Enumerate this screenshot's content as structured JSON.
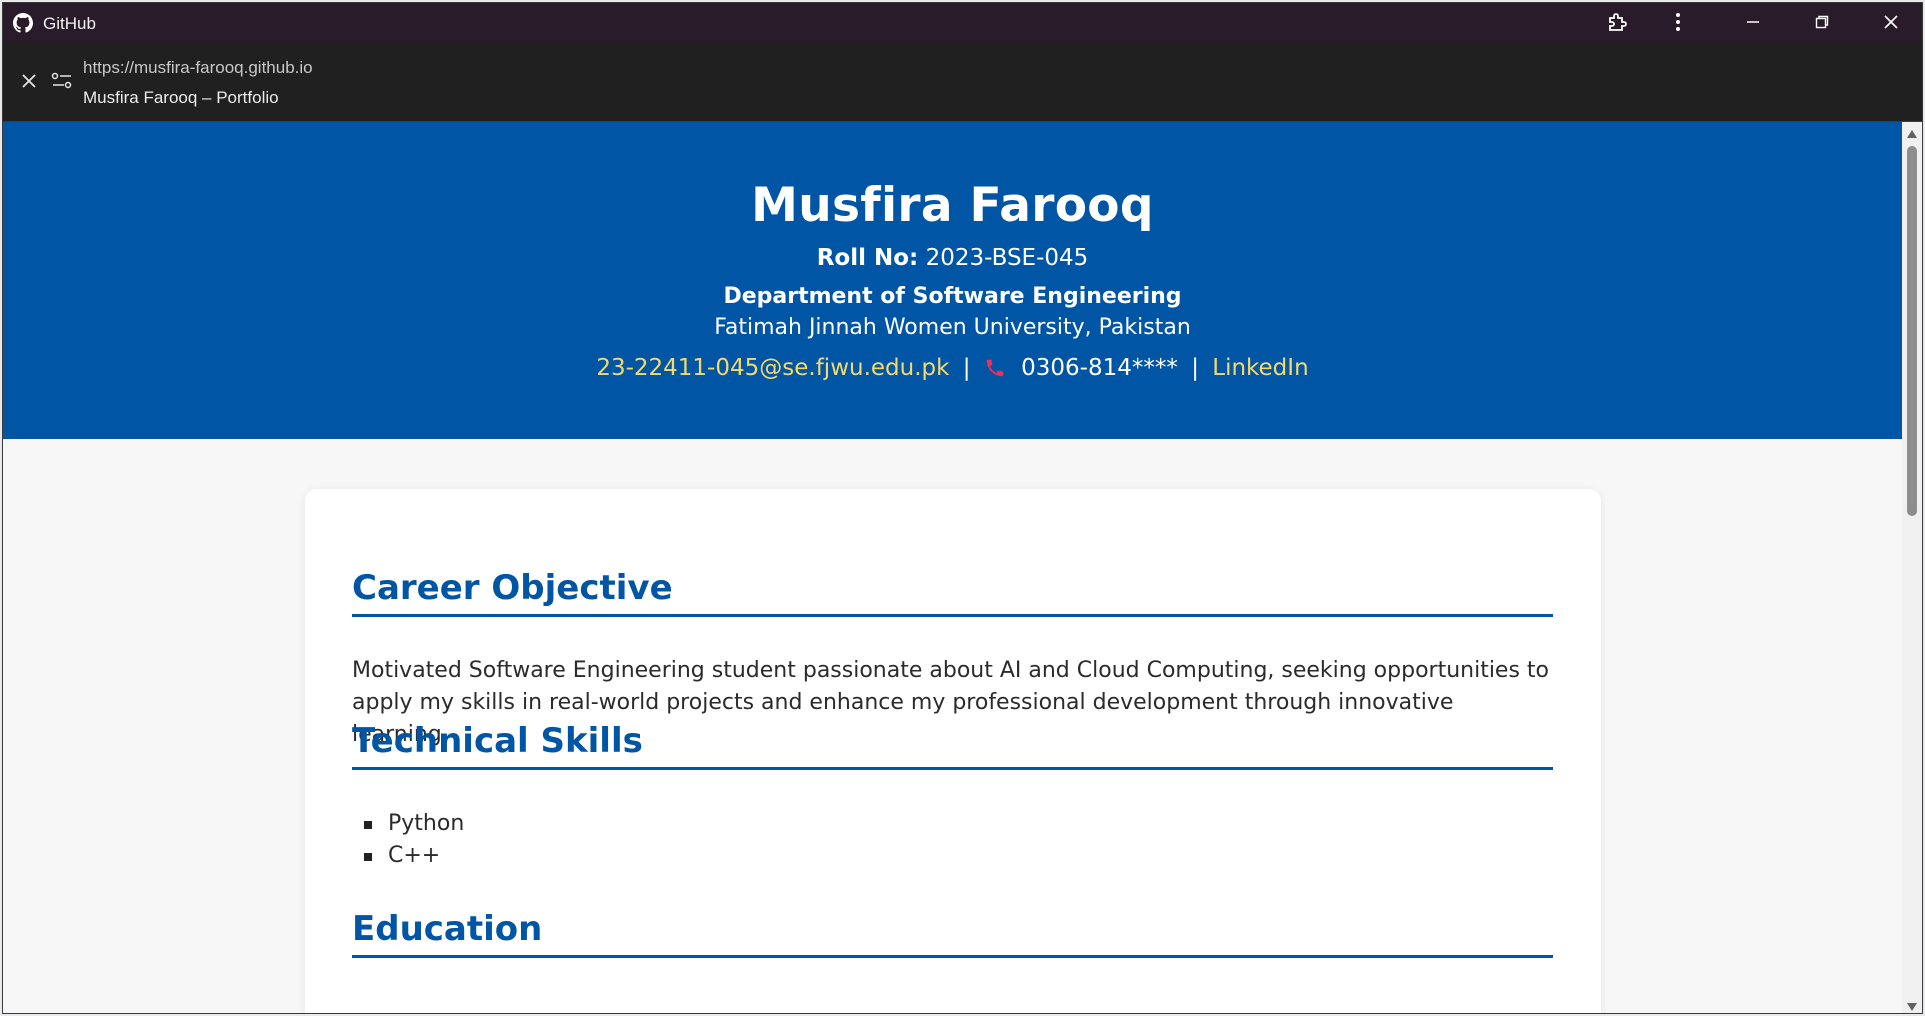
{
  "window": {
    "app_title": "GitHub",
    "url": "https://musfira-farooq.github.io",
    "page_title": "Musfira Farooq – Portfolio"
  },
  "hero": {
    "name": "Musfira Farooq",
    "roll_label": "Roll No:",
    "roll_value": "2023-BSE-045",
    "department": "Department of Software Engineering",
    "university": "Fatimah Jinnah Women University, Pakistan",
    "email": "23-22411-045@se.fjwu.edu.pk",
    "separator": "|",
    "phone": "0306-814****",
    "linkedin": "LinkedIn"
  },
  "sections": {
    "objective_title": "Career Objective",
    "objective_text": "Motivated Software Engineering student passionate about AI and Cloud Computing, seeking opportunities to apply my skills in real-world projects and enhance my professional development through innovative learning.",
    "skills_title": "Technical Skills",
    "skills": [
      "Python",
      "C++"
    ],
    "education_title": "Education"
  },
  "colors": {
    "brand_blue": "#0155a5",
    "link_yellow": "#f6d96b",
    "titlebar": "#2a1b2b",
    "phone_icon": "#e8305a"
  },
  "icons": {
    "app": "github-icon",
    "extensions": "puzzle-icon",
    "menu": "kebab-menu-icon",
    "minimize": "minimize-icon",
    "restore": "restore-icon",
    "close": "close-icon",
    "addr_close": "close-icon",
    "site_settings": "tune-icon",
    "phone": "phone-icon"
  }
}
